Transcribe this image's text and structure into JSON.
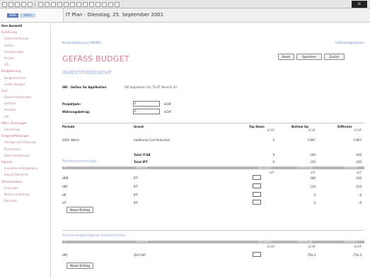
{
  "window": {
    "ie_label": "IE"
  },
  "logo": {
    "brand_left": "iBSM",
    "brand_right": "SMSS"
  },
  "header": {
    "title": "IT Plan - Dienstag, 25. September 2001"
  },
  "sidebar": {
    "items": [
      {
        "label": "Ihre Auswahl",
        "level": "top"
      },
      {
        "label": "Einführung",
        "level": "main"
      },
      {
        "label": "Dokumentierung",
        "level": "sub"
      },
      {
        "label": "Gefäss",
        "level": "sub"
      },
      {
        "label": "Umsetzungen",
        "level": "sub"
      },
      {
        "label": "Projekt",
        "level": "sub"
      },
      {
        "label": "VSL",
        "level": "sub"
      },
      {
        "label": "Budgetierung",
        "level": "main"
      },
      {
        "label": "Budgetstruktur",
        "level": "sub"
      },
      {
        "label": "Gefäss Budget",
        "level": "sub"
      },
      {
        "label": "Lauf",
        "level": "main"
      },
      {
        "label": "Dokumentierungen",
        "level": "sub"
      },
      {
        "label": "Gefässe",
        "level": "sub"
      },
      {
        "label": "Projekte",
        "level": "sub"
      },
      {
        "label": "VSL",
        "level": "sub"
      },
      {
        "label": "KBS-C Buchungen",
        "level": "main"
      },
      {
        "label": "Controlling",
        "level": "sub"
      },
      {
        "label": "Ereignis/Meldungen",
        "level": "main"
      },
      {
        "label": "Anträge auf Erfassung",
        "level": "sub"
      },
      {
        "label": "Dokumente",
        "level": "sub"
      },
      {
        "label": "Detail Verwaltung",
        "level": "sub"
      },
      {
        "label": "Reports",
        "level": "main"
      },
      {
        "label": "Investitions-Budgetplan",
        "level": "sub"
      },
      {
        "label": "Report Übersicht",
        "level": "sub"
      },
      {
        "label": "Administration",
        "level": "main"
      },
      {
        "label": "Formulare",
        "level": "sub"
      },
      {
        "label": "Nutzerverwaltung",
        "level": "sub"
      },
      {
        "label": "Benutzer",
        "level": "sub"
      }
    ]
  },
  "main": {
    "breadcrumb": "Kundenbetreuung (VABIEN)",
    "help_link": "Gefässbudgetplanen",
    "title": "GEFÄSS BUDGET",
    "subtitle": "INVESTITIONSSICHT",
    "buttons": {
      "reset": "Reset",
      "save": "Speichern",
      "back": "Zurück"
    },
    "section_label": "SBI - Gefäss für Applikation",
    "section_value": "FW Applikation (A), TL/UT Bereich (G)",
    "fields": [
      {
        "label": "Projektjahr:",
        "value": "0",
        "unit": "kCHF"
      },
      {
        "label": "Währungsbetrag:",
        "value": "0",
        "unit": "kCHF"
      }
    ],
    "table1": {
      "headers": [
        "Periode",
        "Grund",
        "Top Down",
        "Bottom Up",
        "Differenz"
      ],
      "unit_row": [
        "kCHF",
        "kCHF",
        "kCHF"
      ],
      "rows": [
        {
          "periode": "2001 (Wert)",
          "grund": "Additional Cost Reduction",
          "top": "0",
          "bottom": "1'897",
          "diff": "-1'865"
        }
      ],
      "totals": [
        {
          "label": "Total IT-SB",
          "top": "0",
          "bottom": "160",
          "diff": "-160"
        },
        {
          "label": "Total IPT",
          "top": "0",
          "bottom": "230",
          "diff": "-230"
        }
      ]
    },
    "section2": {
      "title": "Personenmatrage",
      "bar": [
        "IT",
        "Bestand",
        "Top Down",
        "Bottom Up",
        "Differenz"
      ],
      "unit_row": [
        "a/IT",
        "a/IT",
        "a/IT"
      ],
      "rows": [
        {
          "code": "HRB",
          "type": "IPT",
          "top": "",
          "bottom": "180",
          "diff": "-160"
        },
        {
          "code": "HPC",
          "type": "IPT",
          "top": "",
          "bottom": "120",
          "diff": "-120"
        },
        {
          "code": "HP",
          "type": "IPT",
          "top": "",
          "bottom": "0",
          "diff": "-0"
        },
        {
          "code": "HT",
          "type": "IPT",
          "top": "",
          "bottom": "0",
          "diff": "-0"
        }
      ],
      "add_button": "Neuer Eintrag"
    },
    "section3": {
      "title": "Personenbezogene Investitionen",
      "bar": [
        "IT",
        "Bestand",
        "Top Down",
        "Bottom Up",
        "Differenz"
      ],
      "unit_row": [
        "kCHF",
        "kCHF",
        "kCHF"
      ],
      "rows": [
        {
          "code": "HPC",
          "type": "QIA-CHP",
          "top": "",
          "bottom": "750.4",
          "diff": "-750.4"
        }
      ],
      "add_button": "Neuer Eintrag"
    }
  }
}
